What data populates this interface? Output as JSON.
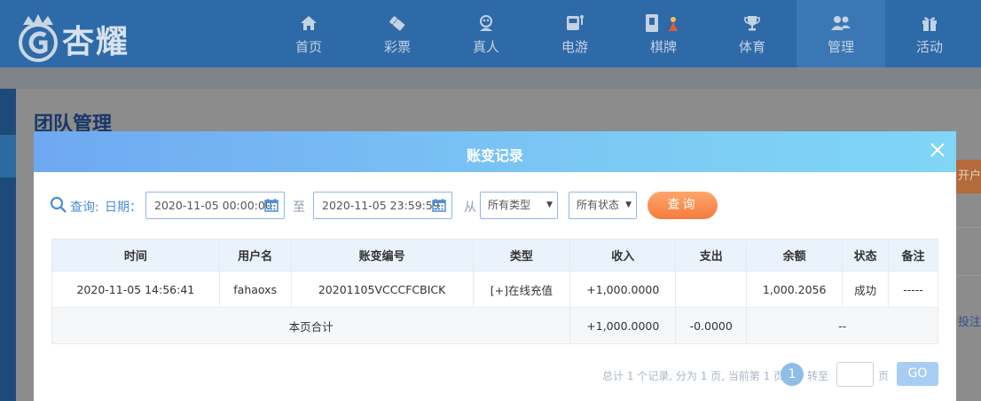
{
  "brand": {
    "logo_text": "杏耀"
  },
  "nav": {
    "items": [
      {
        "label": "首页",
        "icon": "home-icon"
      },
      {
        "label": "彩票",
        "icon": "lottery-icon"
      },
      {
        "label": "真人",
        "icon": "live-dealer-icon"
      },
      {
        "label": "电游",
        "icon": "slot-machine-icon"
      },
      {
        "label": "棋牌",
        "icon": "card-game-icon"
      },
      {
        "label": "体育",
        "icon": "trophy-icon"
      },
      {
        "label": "管理",
        "icon": "users-icon"
      },
      {
        "label": "活动",
        "icon": "gift-icon"
      }
    ],
    "active_index": 6
  },
  "page": {
    "title": "团队管理",
    "side_tab_label": "开户",
    "side_link_label": "投注"
  },
  "modal": {
    "title": "账变记录",
    "filter": {
      "query_label": "查询:",
      "date_label": "日期：",
      "start_date": "2020-11-05 00:00:00",
      "to_label": "至",
      "end_date": "2020-11-05 23:59:59",
      "from_label": "从",
      "type_select": "所有类型",
      "status_select": "所有状态",
      "query_button": "查询"
    },
    "table": {
      "headers": [
        "时间",
        "用户名",
        "账变编号",
        "类型",
        "收入",
        "支出",
        "余额",
        "状态",
        "备注"
      ],
      "rows": [
        {
          "time": "2020-11-05 14:56:41",
          "username": "fahaoxs",
          "change_id": "20201105VCCCFCBICK",
          "type": "[+]在线充值",
          "income": "+1,000.0000",
          "expense": "",
          "balance": "1,000.2056",
          "status": "成功",
          "remark": "-----"
        }
      ],
      "total": {
        "label": "本页合计",
        "income": "+1,000.0000",
        "expense": "-0.0000",
        "rest": "--"
      }
    },
    "pagination": {
      "summary": "总计 1 个记录, 分为 1 页, 当前第 1 页",
      "current_page": "1",
      "jump_label": "转至",
      "page_suffix": "页",
      "go_button": "GO"
    }
  },
  "colors": {
    "nav_bg": "#2e6aa8",
    "modal_header_start": "#6fa8f2",
    "modal_header_end": "#7fd6f6",
    "query_button": "#f47c3c",
    "income_green": "#3a9a3a",
    "accent_blue": "#4a8ed8"
  }
}
